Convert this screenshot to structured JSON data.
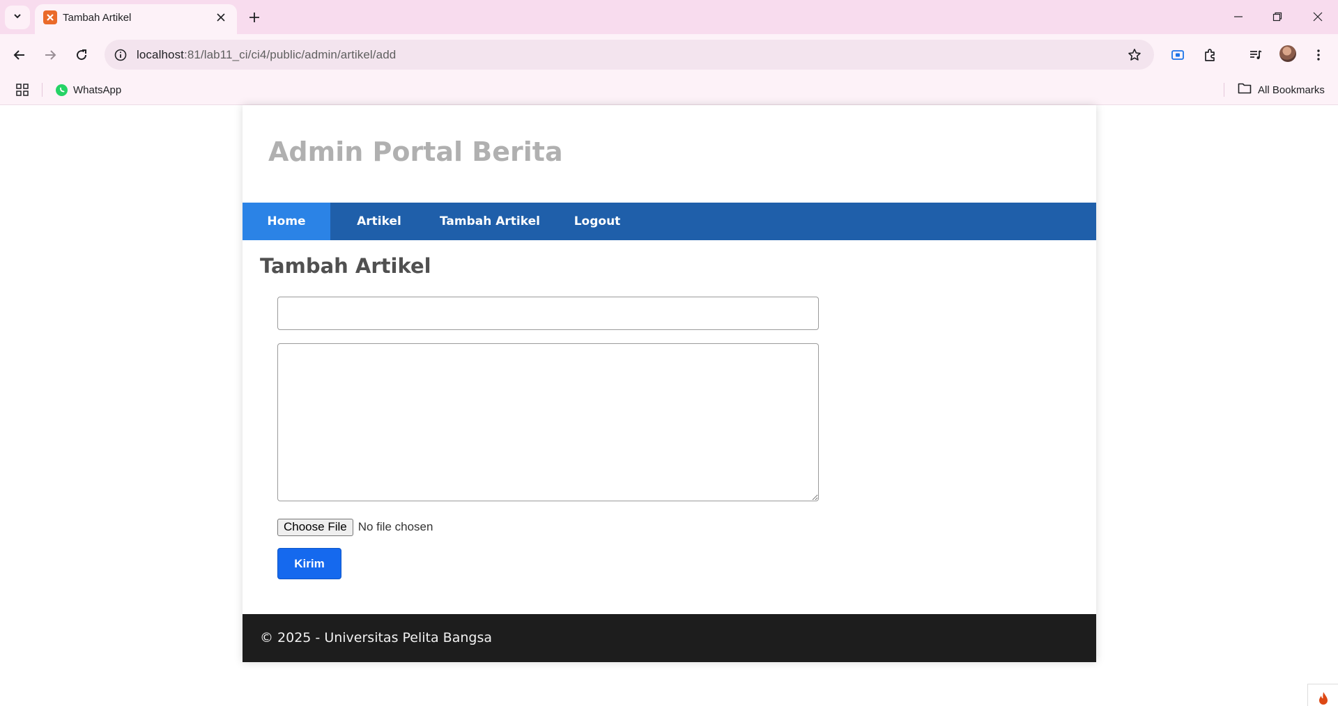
{
  "browser": {
    "tab_title": "Tambah Artikel",
    "url_host": "localhost",
    "url_path": ":81/lab11_ci/ci4/public/admin/artikel/add",
    "bookmarks": {
      "whatsapp": "WhatsApp",
      "all_bookmarks": "All Bookmarks"
    }
  },
  "site": {
    "title": "Admin Portal Berita",
    "nav": [
      "Home",
      "Artikel",
      "Tambah Artikel",
      "Logout"
    ],
    "active_nav": "Home",
    "nav_color": "#1f5faa",
    "nav_active_color": "#2b83e6"
  },
  "form": {
    "heading": "Tambah Artikel",
    "title_value": "",
    "body_value": "",
    "file_button": "Choose File",
    "file_status": "No file chosen",
    "submit_label": "Kirim",
    "submit_color": "#1569ee"
  },
  "footer": {
    "text": "© 2025 - Universitas Pelita Bangsa"
  }
}
